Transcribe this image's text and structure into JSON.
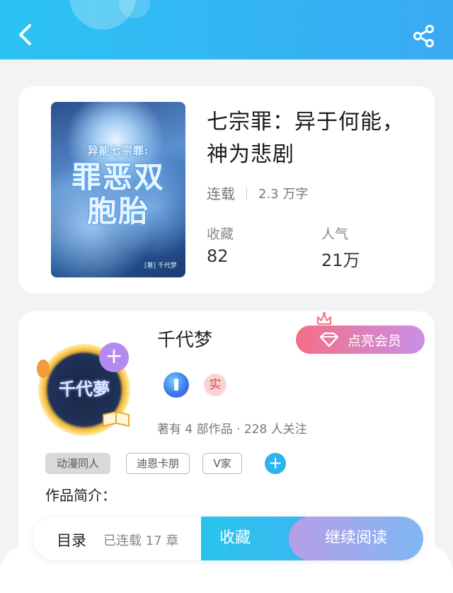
{
  "header": {
    "back_icon": "back-chevron-icon",
    "share_icon": "share-icon",
    "gradient": [
      "#2cc3f3",
      "#3aaaf3"
    ]
  },
  "book": {
    "title": "七宗罪：异于何能，神为悲剧",
    "status": "连载",
    "word_count": "2.3 万字",
    "favorites_label": "收藏",
    "favorites_value": "82",
    "popularity_label": "人气",
    "popularity_value": "21万",
    "cover": {
      "subtitle": "异能七宗罪:",
      "main_title": "罪恶双胞胎",
      "author": "[著] 千代梦"
    }
  },
  "author": {
    "name": "千代梦",
    "avatar_text": "千代夢",
    "vip_button": "点亮会员",
    "real_badge": "实",
    "stats": "著有 4 部作品 · 228 人关注",
    "tags": [
      "动漫同人",
      "迪恩卡朋",
      "V家"
    ],
    "intro_label": "作品简介："
  },
  "bottom_bar": {
    "toc_label": "目录",
    "chapter_count": "已连载 17 章",
    "favorite_button": "收藏",
    "read_button": "继续阅读"
  },
  "colors": {
    "accent_blue": "#2cb3f0",
    "vip_gradient": [
      "#f46f86",
      "#c98fe8"
    ],
    "read_gradient": [
      "#b89ee8",
      "#7fb7f2"
    ]
  }
}
